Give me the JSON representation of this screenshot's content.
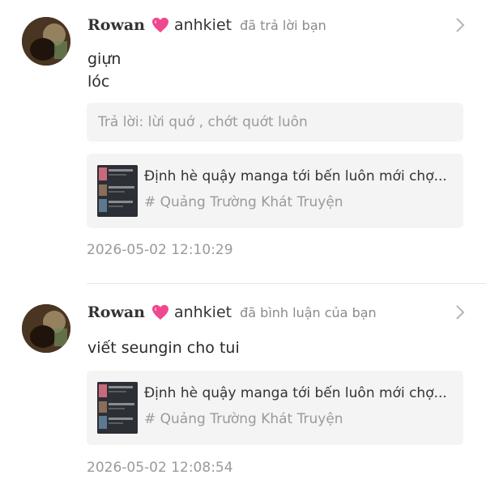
{
  "notifications": [
    {
      "username": "Rowan",
      "handle": "anhkiet",
      "action": "đã trả lời bạn",
      "message_lines": [
        "giựn",
        "lóc"
      ],
      "reply": "Trả lời: lừi quớ , chớt quớt luôn",
      "post": {
        "title": "Định hè quậy manga tới bến luôn mới chợ...",
        "topic": "# Quảng Trường Khát Truyện"
      },
      "timestamp": "2026-05-02 12:10:29"
    },
    {
      "username": "Rowan",
      "handle": "anhkiet",
      "action": "đã bình luận của bạn",
      "message_lines": [
        "viết seungin cho tui"
      ],
      "post": {
        "title": "Định hè quậy manga tới bến luôn mới chợ...",
        "topic": "# Quảng Trường Khát Truyện"
      },
      "timestamp": "2026-05-02 12:08:54"
    }
  ],
  "colors": {
    "heart": "#f0488f",
    "muted_text": "#9a9a9a",
    "card_bg": "#f4f4f4"
  },
  "icons": [
    "avatar",
    "heart-icon",
    "chevron-right-icon",
    "post-thumbnail"
  ]
}
